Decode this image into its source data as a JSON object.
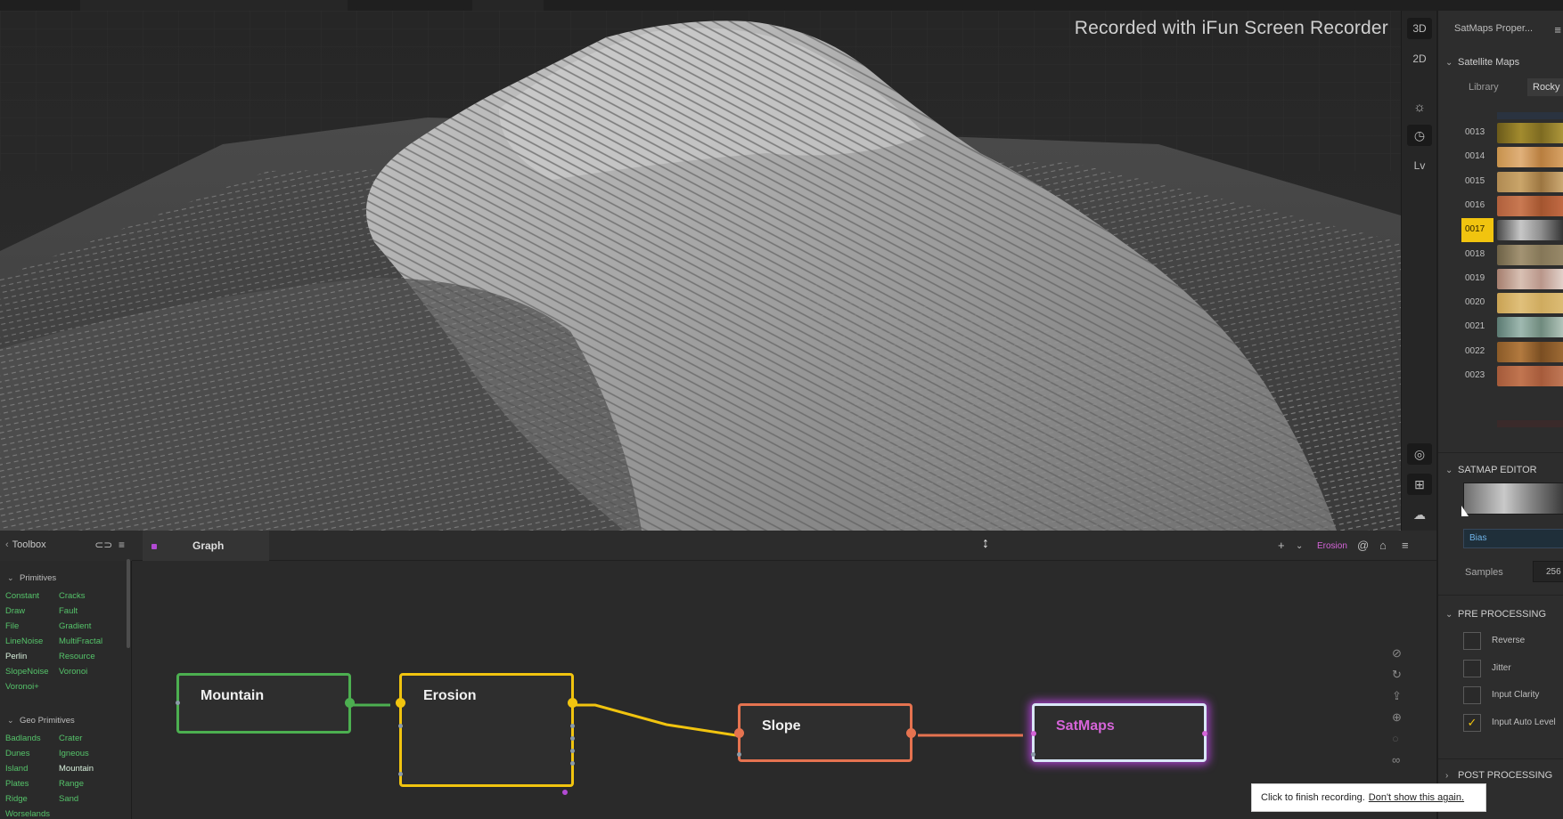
{
  "watermark": "Recorded with iFun Screen Recorder",
  "viewport_tools": {
    "btn_3d": "3D",
    "btn_2d": "2D",
    "btn_lv": "Lv"
  },
  "properties": {
    "title": "SatMaps Proper...",
    "satellite_maps": {
      "header": "Satellite Maps",
      "tab_library": "Library",
      "tab_rocky": "Rocky",
      "swatches": [
        {
          "id": "0013",
          "colors": [
            "#6b5a1a",
            "#a28b2e",
            "#7d6a21",
            "#b09a3d"
          ]
        },
        {
          "id": "0014",
          "colors": [
            "#c7924c",
            "#e0b07a",
            "#b87e3f",
            "#d9a467"
          ]
        },
        {
          "id": "0015",
          "colors": [
            "#b08a52",
            "#caa56a",
            "#9c7641",
            "#d0ad77"
          ]
        },
        {
          "id": "0016",
          "colors": [
            "#b0603c",
            "#c97952",
            "#a3552f",
            "#c46b45"
          ]
        },
        {
          "id": "0017",
          "colors": [
            "#4a4a4a",
            "#c7c7c7",
            "#8e8e8e",
            "#2e2e2e"
          ],
          "selected": true
        },
        {
          "id": "0018",
          "colors": [
            "#6d6146",
            "#a39373",
            "#857758",
            "#998a6a"
          ]
        },
        {
          "id": "0019",
          "colors": [
            "#a57e6e",
            "#d8c0b3",
            "#b9968a",
            "#e5d6cf"
          ]
        },
        {
          "id": "0020",
          "colors": [
            "#c9a253",
            "#e0c07b",
            "#cfab5f",
            "#ddbd76"
          ]
        },
        {
          "id": "0021",
          "colors": [
            "#5b7a72",
            "#9fb9b0",
            "#6f8a7d",
            "#b7c9bf"
          ]
        },
        {
          "id": "0022",
          "colors": [
            "#8a5a28",
            "#b27a3f",
            "#7a4e22",
            "#a06c36"
          ]
        },
        {
          "id": "0023",
          "colors": [
            "#a45a3a",
            "#c17550",
            "#a65b3b",
            "#c27a58"
          ]
        }
      ]
    },
    "satmap_editor": {
      "header": "SATMAP EDITOR",
      "bias_label": "Bias",
      "samples_label": "Samples",
      "samples_value": "256"
    },
    "pre_processing": {
      "header": "PRE PROCESSING",
      "options": [
        {
          "label": "Reverse",
          "checked": false
        },
        {
          "label": "Jitter",
          "checked": false
        },
        {
          "label": "Input Clarity",
          "checked": false
        },
        {
          "label": "Input Auto Level",
          "checked": true
        }
      ]
    },
    "post_processing": {
      "header": "POST PROCESSING"
    }
  },
  "toolbox": {
    "title": "Toolbox",
    "primitives_header": "Primitives",
    "primitives": [
      [
        "Constant",
        "Cracks"
      ],
      [
        "Draw",
        "Fault"
      ],
      [
        "File",
        "Gradient"
      ],
      [
        "LineNoise",
        "MultiFractal"
      ],
      [
        "Perlin",
        "Resource"
      ],
      [
        "SlopeNoise",
        "Voronoi"
      ],
      [
        "Voronoi+",
        ""
      ]
    ],
    "geo_header": "Geo Primitives",
    "geo_primitives": [
      [
        "Badlands",
        "Crater"
      ],
      [
        "Dunes",
        "Igneous"
      ],
      [
        "Island",
        "Mountain"
      ],
      [
        "Plates",
        "Range"
      ],
      [
        "Ridge",
        "Sand"
      ],
      [
        "Worselands",
        ""
      ]
    ]
  },
  "graph": {
    "tab_label": "Graph",
    "active_node_label": "Erosion",
    "nodes": {
      "mountain": "Mountain",
      "erosion": "Erosion",
      "slope": "Slope",
      "satmaps": "SatMaps"
    }
  },
  "toast": {
    "text": "Click to finish recording.",
    "link": "Don't show this again."
  }
}
